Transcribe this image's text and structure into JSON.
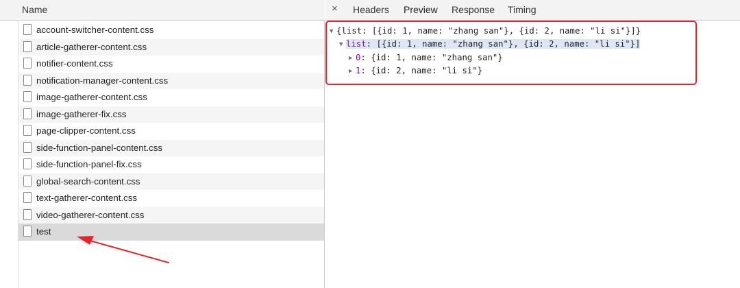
{
  "network": {
    "column_header": "Name",
    "files": [
      {
        "name": "account-switcher-content.css"
      },
      {
        "name": "article-gatherer-content.css"
      },
      {
        "name": "notifier-content.css"
      },
      {
        "name": "notification-manager-content.css"
      },
      {
        "name": "image-gatherer-content.css"
      },
      {
        "name": "image-gatherer-fix.css"
      },
      {
        "name": "page-clipper-content.css"
      },
      {
        "name": "side-function-panel-content.css"
      },
      {
        "name": "side-function-panel-fix.css"
      },
      {
        "name": "global-search-content.css"
      },
      {
        "name": "text-gatherer-content.css"
      },
      {
        "name": "video-gatherer-content.css"
      },
      {
        "name": "test",
        "selected": true
      }
    ]
  },
  "panel": {
    "close_glyph": "×",
    "tabs": [
      {
        "label": "Headers"
      },
      {
        "label": "Preview",
        "active": true
      },
      {
        "label": "Response"
      },
      {
        "label": "Timing"
      }
    ]
  },
  "preview": {
    "root": "{list: [{id: 1, name: \"zhang san\"}, {id: 2, name: \"li si\"}]}",
    "list_key": "list",
    "list_value": "[{id: 1, name: \"zhang san\"}, {id: 2, name: \"li si\"}]",
    "items": [
      {
        "index": "0",
        "value": "{id: 1, name: \"zhang san\"}"
      },
      {
        "index": "1",
        "value": "{id: 2, name: \"li si\"}"
      }
    ]
  },
  "annotation": {
    "box_color": "#e8232b",
    "arrow_color": "#e8232b"
  },
  "icons": {
    "expanded": "expanded-triangle-icon",
    "collapsed": "collapsed-triangle-icon",
    "file": "file-icon"
  }
}
